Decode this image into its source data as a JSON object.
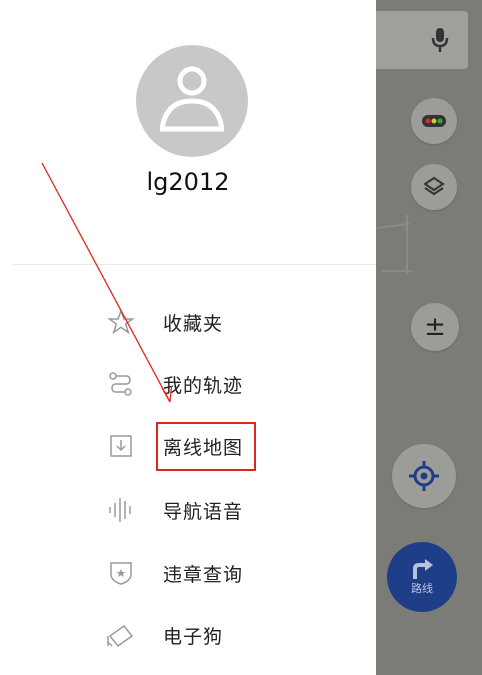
{
  "user": {
    "name": "lg2012"
  },
  "menu": {
    "items": [
      {
        "label": "收藏夹",
        "icon": "star-outline-icon"
      },
      {
        "label": "我的轨迹",
        "icon": "track-path-icon"
      },
      {
        "label": "离线地图",
        "icon": "download-box-icon"
      },
      {
        "label": "导航语音",
        "icon": "voice-wave-icon"
      },
      {
        "label": "违章查询",
        "icon": "shield-star-icon"
      },
      {
        "label": "电子狗",
        "icon": "camera-icon"
      }
    ]
  },
  "map": {
    "route_label": "路线",
    "zoom_label": "±"
  },
  "annotation": {
    "color": "#e0261b"
  }
}
